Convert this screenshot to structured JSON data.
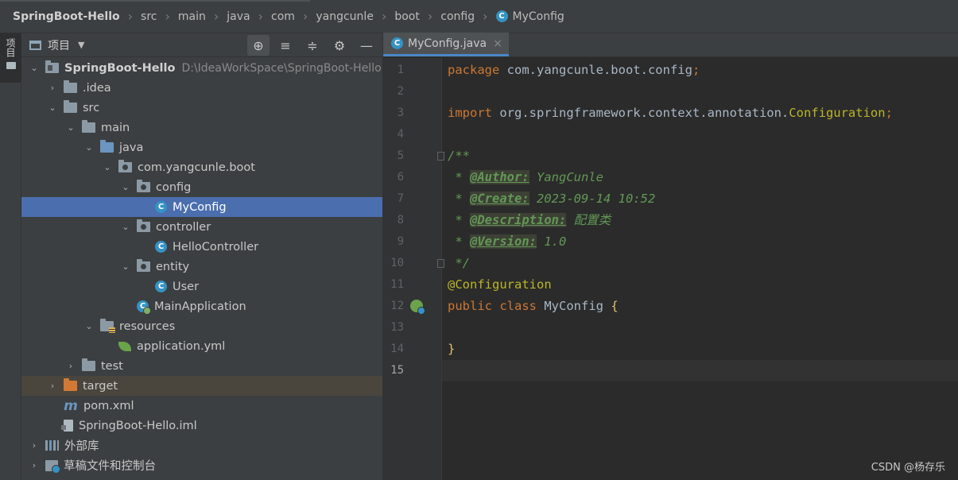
{
  "breadcrumb": [
    "SpringBoot-Hello",
    "src",
    "main",
    "java",
    "com",
    "yangcunle",
    "boot",
    "config",
    "MyConfig"
  ],
  "class_badge": "C",
  "tool_stripe": {
    "label": "项目"
  },
  "project_panel": {
    "title": "项目",
    "caret": "▼",
    "tools": [
      "⊕",
      "≡",
      "≑",
      "⚙",
      "—"
    ]
  },
  "tree": [
    {
      "depth": 0,
      "arrow": "⌄",
      "icon": "module-folder",
      "label": "SpringBoot-Hello",
      "hint": "D:\\IdeaWorkSpace\\SpringBoot-Hello",
      "bold": true
    },
    {
      "depth": 1,
      "arrow": "›",
      "icon": "folder",
      "label": ".idea"
    },
    {
      "depth": 1,
      "arrow": "⌄",
      "icon": "folder",
      "label": "src"
    },
    {
      "depth": 2,
      "arrow": "⌄",
      "icon": "folder",
      "label": "main"
    },
    {
      "depth": 3,
      "arrow": "⌄",
      "icon": "folder-blue",
      "label": "java"
    },
    {
      "depth": 4,
      "arrow": "⌄",
      "icon": "package",
      "label": "com.yangcunle.boot"
    },
    {
      "depth": 5,
      "arrow": "⌄",
      "icon": "package",
      "label": "config"
    },
    {
      "depth": 6,
      "arrow": "",
      "icon": "class",
      "label": "MyConfig",
      "selected": true
    },
    {
      "depth": 5,
      "arrow": "⌄",
      "icon": "package",
      "label": "controller"
    },
    {
      "depth": 6,
      "arrow": "",
      "icon": "class",
      "label": "HelloController"
    },
    {
      "depth": 5,
      "arrow": "⌄",
      "icon": "package",
      "label": "entity"
    },
    {
      "depth": 6,
      "arrow": "",
      "icon": "class",
      "label": "User"
    },
    {
      "depth": 5,
      "arrow": "",
      "icon": "main-class",
      "label": "MainApplication"
    },
    {
      "depth": 3,
      "arrow": "⌄",
      "icon": "resources",
      "label": "resources"
    },
    {
      "depth": 4,
      "arrow": "",
      "icon": "spring-yml",
      "label": "application.yml"
    },
    {
      "depth": 2,
      "arrow": "›",
      "icon": "folder",
      "label": "test"
    },
    {
      "depth": 1,
      "arrow": "›",
      "icon": "folder-orange",
      "label": "target",
      "excluded": true
    },
    {
      "depth": 1,
      "arrow": "",
      "icon": "maven",
      "label": "pom.xml"
    },
    {
      "depth": 1,
      "arrow": "",
      "icon": "iml",
      "label": "SpringBoot-Hello.iml"
    },
    {
      "depth": 0,
      "arrow": "›",
      "icon": "library",
      "label": "外部库"
    },
    {
      "depth": 0,
      "arrow": "›",
      "icon": "scratch",
      "label": "草稿文件和控制台"
    }
  ],
  "editor": {
    "tab_label": "MyConfig.java",
    "tab_close": "×",
    "current_line": 15,
    "lines": [
      [
        {
          "t": "package ",
          "c": "kw"
        },
        {
          "t": "com.yangcunle.boot.config",
          "c": "cls"
        },
        {
          "t": ";",
          "c": "pun"
        }
      ],
      [],
      [
        {
          "t": "import ",
          "c": "kw"
        },
        {
          "t": "org.springframework.context.annotation.",
          "c": "cls"
        },
        {
          "t": "Configuration",
          "c": "ann"
        },
        {
          "t": ";",
          "c": "pun"
        }
      ],
      [],
      [
        {
          "t": "/**",
          "c": "doc"
        }
      ],
      [
        {
          "t": " * ",
          "c": "doc"
        },
        {
          "t": "@Author:",
          "c": "tag"
        },
        {
          "t": " YangCunle",
          "c": "doc"
        }
      ],
      [
        {
          "t": " * ",
          "c": "doc"
        },
        {
          "t": "@Create:",
          "c": "tag"
        },
        {
          "t": " 2023-09-14 10:52",
          "c": "doc"
        }
      ],
      [
        {
          "t": " * ",
          "c": "doc"
        },
        {
          "t": "@Description:",
          "c": "tag"
        },
        {
          "t": " 配置类",
          "c": "doc"
        }
      ],
      [
        {
          "t": " * ",
          "c": "doc"
        },
        {
          "t": "@Version:",
          "c": "tag"
        },
        {
          "t": " 1.0",
          "c": "doc"
        }
      ],
      [
        {
          "t": " */",
          "c": "doc"
        }
      ],
      [
        {
          "t": "@Configuration",
          "c": "ann"
        }
      ],
      [
        {
          "t": "public ",
          "c": "kw"
        },
        {
          "t": "class ",
          "c": "kw"
        },
        {
          "t": "MyConfig ",
          "c": "cls"
        },
        {
          "t": "{",
          "c": "brace"
        }
      ],
      [],
      [
        {
          "t": "}",
          "c": "brace"
        }
      ],
      []
    ]
  },
  "watermark": "CSDN @杨存乐"
}
